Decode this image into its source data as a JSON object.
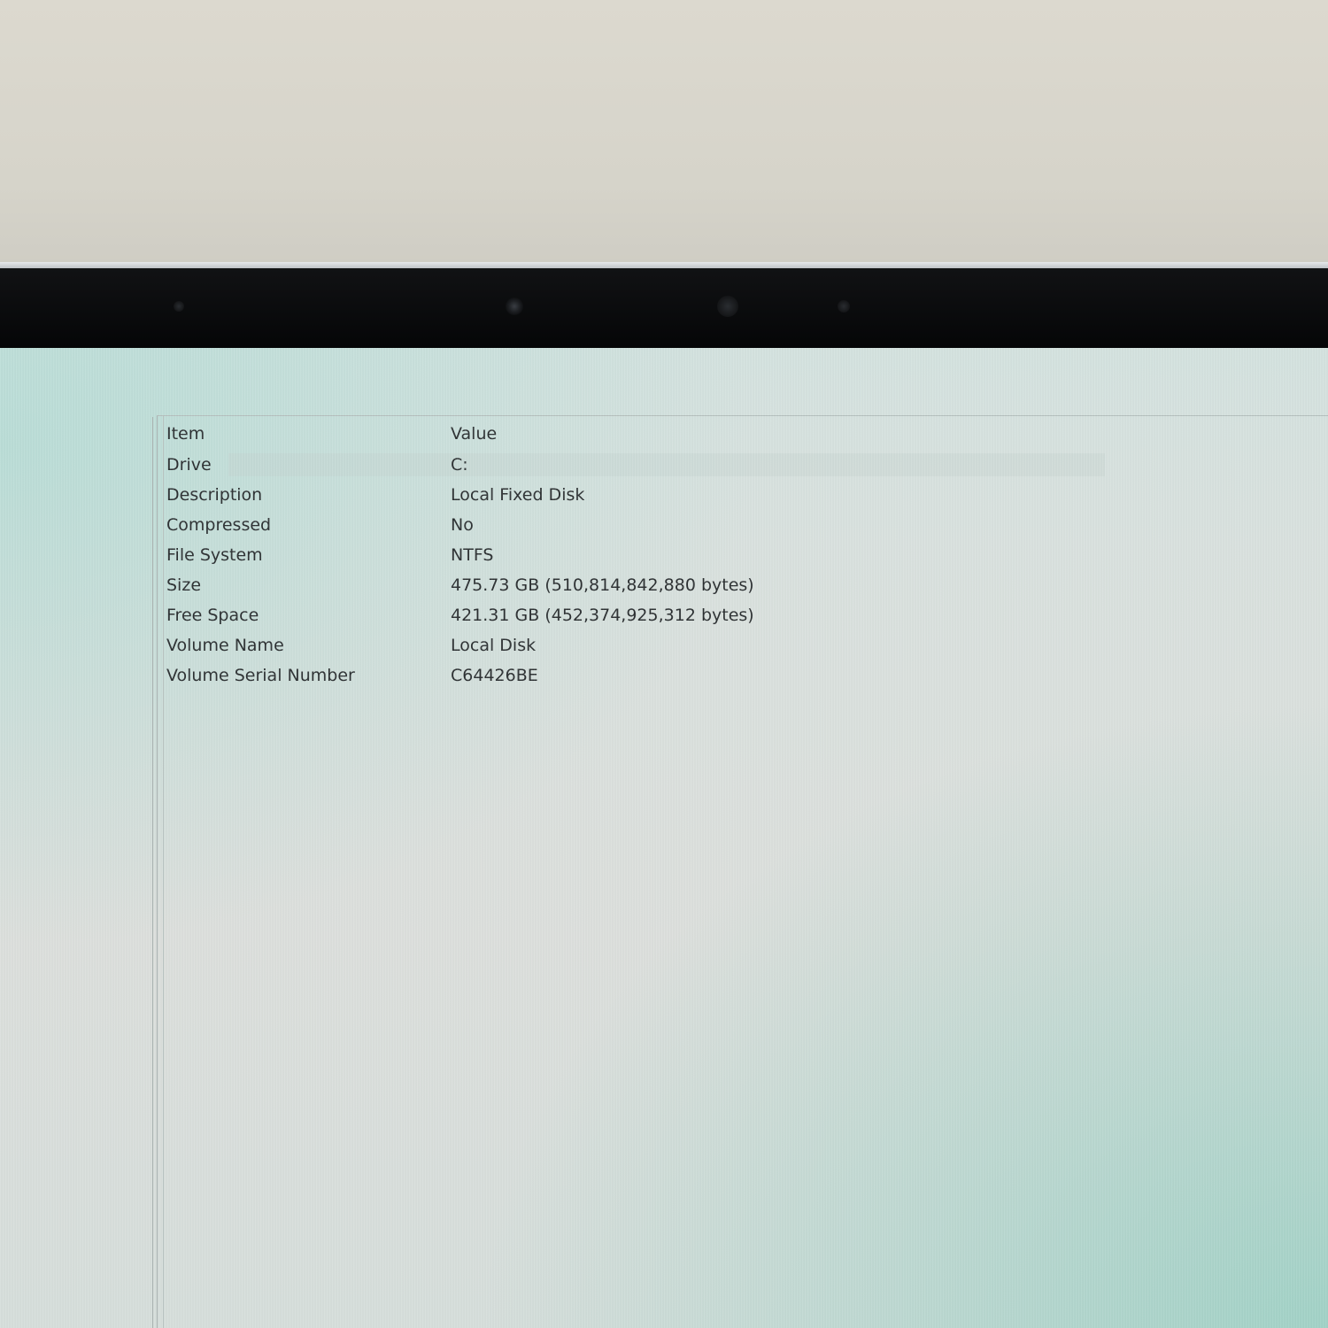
{
  "table": {
    "header": {
      "item": "Item",
      "value": "Value"
    },
    "rows": [
      {
        "item": "Drive",
        "value": "C:"
      },
      {
        "item": "Description",
        "value": "Local Fixed Disk"
      },
      {
        "item": "Compressed",
        "value": "No"
      },
      {
        "item": "File System",
        "value": "NTFS"
      },
      {
        "item": "Size",
        "value": "475.73 GB (510,814,842,880 bytes)"
      },
      {
        "item": "Free Space",
        "value": "421.31 GB (452,374,925,312 bytes)"
      },
      {
        "item": "Volume Name",
        "value": "Local Disk"
      },
      {
        "item": "Volume Serial Number",
        "value": "C64426BE"
      }
    ]
  }
}
